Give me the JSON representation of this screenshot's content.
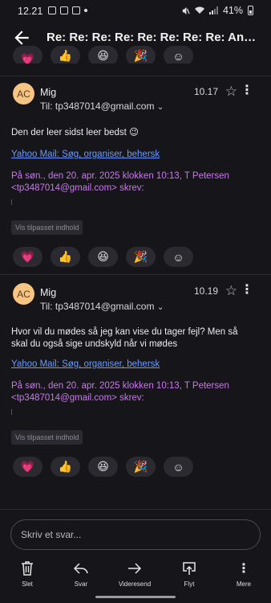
{
  "status": {
    "time": "12.21",
    "battery": "41%"
  },
  "header": {
    "subject": "Re: Re: Re: Re: Re: Re: Re: Re: Annoncering"
  },
  "reactions": [
    "heart",
    "thumbs-up",
    "grin",
    "party",
    "add-reaction"
  ],
  "messages": [
    {
      "avatar": "AC",
      "sender": "Mig",
      "to": "Til: tp3487014@gmail.com",
      "time": "10.17",
      "body": "Den der leer sidst leer bedst 😉",
      "link": "Yahoo Mail: Søg, organiser, behersk",
      "quote": "På søn., den 20. apr. 2025 klokken 10:13, T Petersen <tp3487014@gmail.com> skrev:",
      "tailored": "Vis tilpasset indhold"
    },
    {
      "avatar": "AC",
      "sender": "Mig",
      "to": "Til: tp3487014@gmail.com",
      "time": "10.19",
      "body": "Hvor vil du mødes så jeg kan vise du tager fejl? Men så skal du også sige undskyld når vi mødes",
      "link": "Yahoo Mail: Søg, organiser, behersk",
      "quote": "På søn., den 20. apr. 2025 klokken 10:13, T Petersen <tp3487014@gmail.com> skrev:",
      "tailored": "Vis tilpasset indhold"
    }
  ],
  "compose": {
    "placeholder": "Skriv et svar..."
  },
  "toolbar": {
    "delete": "Slet",
    "reply": "Svar",
    "forward": "Videresend",
    "move": "Flyt",
    "more": "Mere"
  },
  "colors": {
    "background": "#16161a",
    "link": "#6a9bff",
    "quote": "#c879e8",
    "avatar": "#f6c483"
  }
}
